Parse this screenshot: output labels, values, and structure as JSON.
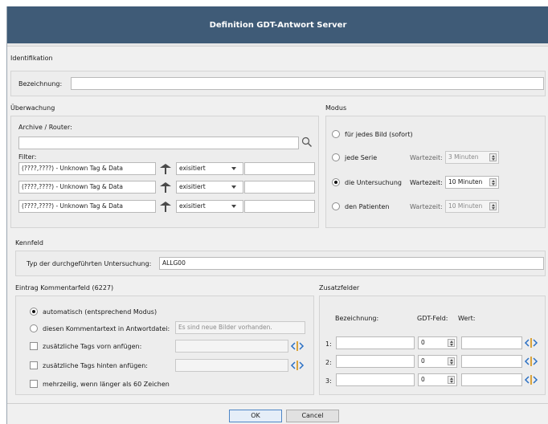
{
  "window": {
    "title": "Definition GDT-Antwort Server"
  },
  "identifikation": {
    "section_label": "Identifikation",
    "bezeichnung_label": "Bezeichnung:",
    "bezeichnung_value": ""
  },
  "ueberwachung": {
    "section_label": "Überwachung",
    "archive_label": "Archive / Router:",
    "archive_value": "",
    "filter_label": "Filter:",
    "filters": [
      {
        "tag": "(????,????) - Unknown Tag & Data",
        "condition": "exisitiert",
        "value": ""
      },
      {
        "tag": "(????,????) - Unknown Tag & Data",
        "condition": "exisitiert",
        "value": ""
      },
      {
        "tag": "(????,????) - Unknown Tag & Data",
        "condition": "exisitiert",
        "value": ""
      }
    ]
  },
  "modus": {
    "section_label": "Modus",
    "wait_label": "Wartezeit:",
    "options": [
      {
        "label": "für jedes Bild (sofort)",
        "selected": false
      },
      {
        "label": "jede Serie",
        "selected": false,
        "wait": "3 Minuten",
        "enabled": false
      },
      {
        "label": "die Untersuchung",
        "selected": true,
        "wait": "10 Minuten",
        "enabled": true
      },
      {
        "label": "den Patienten",
        "selected": false,
        "wait": "10 Minuten",
        "enabled": false
      }
    ]
  },
  "kennfeld": {
    "section_label": "Kennfeld",
    "typ_label": "Typ der durchgeführten Untersuchung:",
    "typ_value": "ALLG00"
  },
  "kommentar": {
    "section_label": "Eintrag Kommentarfeld (6227)",
    "auto_label": "automatisch (entsprechend Modus)",
    "auto_selected": true,
    "custom_label": "diesen Kommentartext in Antwortdatei:",
    "custom_selected": false,
    "custom_placeholder": "Es sind neue Bilder vorhanden.",
    "tags_front_label": "zusätzliche Tags vorn anfügen:",
    "tags_back_label": "zusätzliche Tags hinten anfügen:",
    "multiline_label": "mehrzeilig, wenn länger als 60 Zeichen"
  },
  "zusatz": {
    "section_label": "Zusatzfelder",
    "col_bezeichnung": "Bezeichnung:",
    "col_gdt": "GDT-Feld:",
    "col_wert": "Wert:",
    "rows": [
      {
        "index": "1:",
        "bezeichnung": "",
        "gdt": "0",
        "wert": ""
      },
      {
        "index": "2:",
        "bezeichnung": "",
        "gdt": "0",
        "wert": ""
      },
      {
        "index": "3:",
        "bezeichnung": "",
        "gdt": "0",
        "wert": ""
      }
    ]
  },
  "buttons": {
    "ok": "OK",
    "cancel": "Cancel"
  },
  "colors": {
    "titlebar": "#3f5b77",
    "default_button_border": "#4f86c6"
  }
}
